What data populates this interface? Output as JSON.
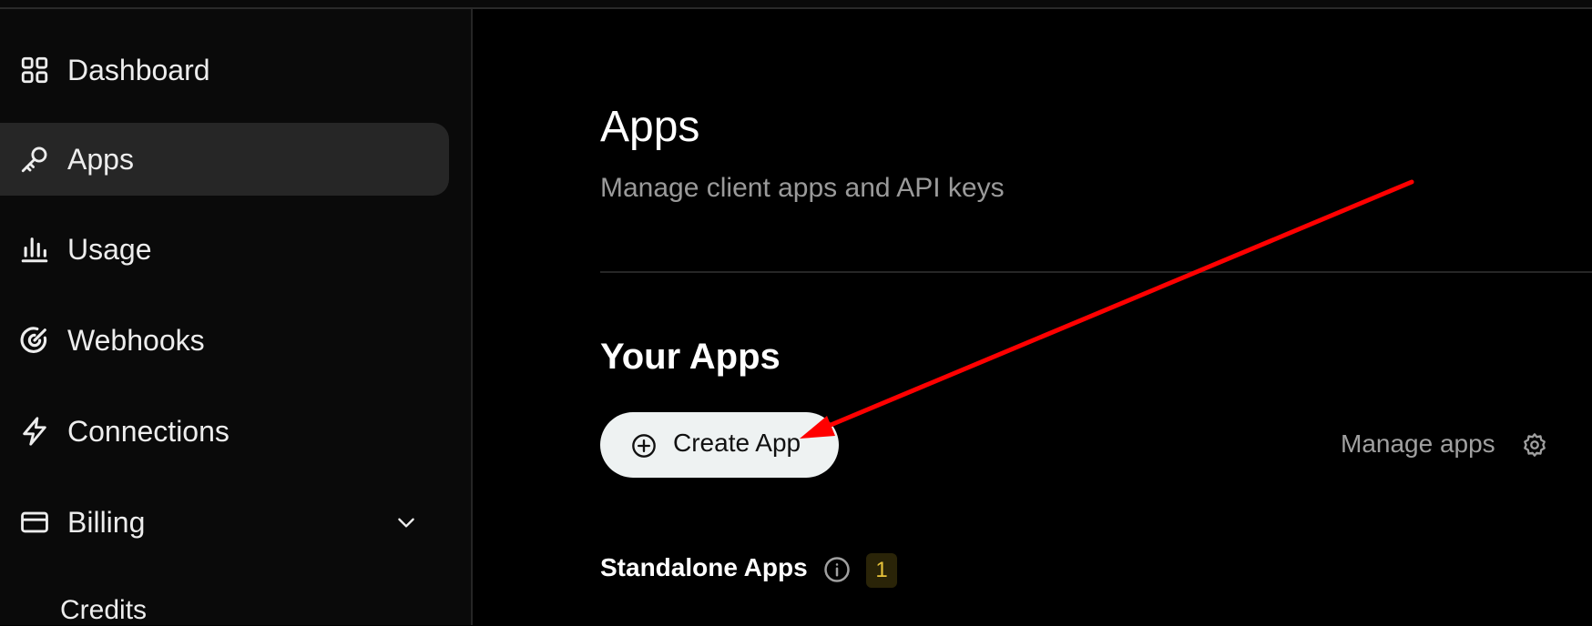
{
  "sidebar": {
    "items": [
      {
        "label": "Dashboard",
        "icon": "grid-icon",
        "active": false
      },
      {
        "label": "Apps",
        "icon": "key-icon",
        "active": true
      },
      {
        "label": "Usage",
        "icon": "bar-chart-icon",
        "active": false
      },
      {
        "label": "Webhooks",
        "icon": "webhook-icon",
        "active": false
      },
      {
        "label": "Connections",
        "icon": "lightning-icon",
        "active": false
      },
      {
        "label": "Billing",
        "icon": "credit-card-icon",
        "active": false,
        "expanded": true
      }
    ],
    "sub_items": [
      {
        "label": "Credits"
      }
    ]
  },
  "main": {
    "title": "Apps",
    "subtitle": "Manage client apps and API keys",
    "section_title": "Your Apps",
    "create_button": {
      "label": "Create App",
      "icon": "plus-circle-icon"
    },
    "manage_link": {
      "label": "Manage apps",
      "icon": "gear-icon"
    },
    "standalone": {
      "label": "Standalone Apps",
      "count": "1",
      "info_icon": "info-icon"
    }
  },
  "annotation": {
    "type": "arrow",
    "color": "#ff0000"
  },
  "colors": {
    "background": "#000000",
    "sidebar": "#0a0a0a",
    "active_item": "#262626",
    "button": "#eef2f2",
    "badge_text": "#e8c33a"
  }
}
